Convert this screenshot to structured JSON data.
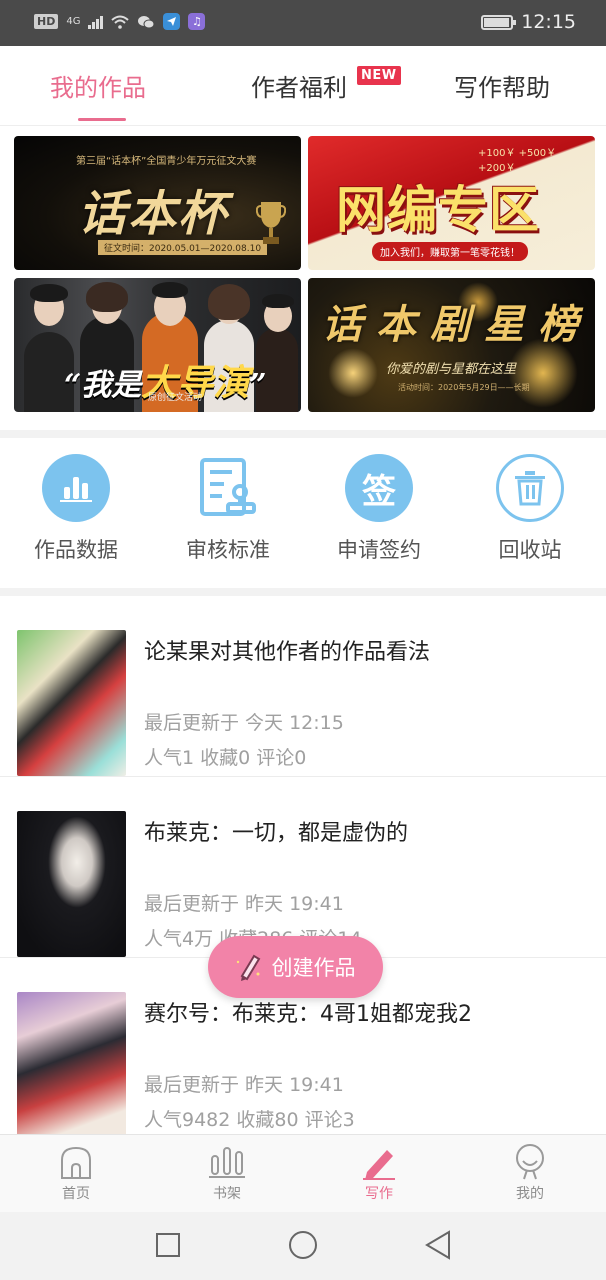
{
  "status_bar": {
    "hd_badge": "HD",
    "network": "4G",
    "time": "12:15",
    "battery_level": 0.9
  },
  "tabs": [
    {
      "label": "我的作品",
      "active": true
    },
    {
      "label": "作者福利",
      "badge": "NEW"
    },
    {
      "label": "写作帮助"
    }
  ],
  "banners": [
    {
      "title": "话本杯",
      "top_text": "第三届“话本杯”全国青少年万元征文大赛",
      "bottom_text": "征文时间：2020.05.01—2020.08.10"
    },
    {
      "title": "网编专区",
      "top_text": "+100￥  +500￥  +200￥",
      "bottom_text": "加入我们，赚取第一笔零花钱！"
    },
    {
      "title_prefix": "“我是",
      "title_main": "大导演",
      "title_suffix": "”",
      "bottom_text": "原创征文活动"
    },
    {
      "title": "话本剧星榜",
      "subtitle": "你爱的剧与星都在这里",
      "bottom_text": "活动时间：2020年5月29日——长期"
    }
  ],
  "actions": [
    {
      "label": "作品数据",
      "icon": "bar-chart-icon",
      "color": "#7cc3ee"
    },
    {
      "label": "审核标准",
      "icon": "review-document-icon",
      "color": "#7cc3ee"
    },
    {
      "label": "申请签约",
      "icon": "sign-icon",
      "icon_text": "签",
      "color": "#7cc3ee"
    },
    {
      "label": "回收站",
      "icon": "trash-icon",
      "color": "#7cc3ee"
    }
  ],
  "works": [
    {
      "title": "论某果对其他作者的作品看法",
      "updated": "最后更新于 今天 12:15",
      "stats": "人气1 收藏0 评论0"
    },
    {
      "title": "布莱克：一切，都是虚伪的",
      "updated": "最后更新于 昨天 19:41",
      "stats": "人气4万 收藏286 评论14"
    },
    {
      "title": "赛尔号：布莱克：4哥1姐都宠我2",
      "updated": "最后更新于 昨天 19:41",
      "stats": "人气9482 收藏80 评论3"
    }
  ],
  "fab": {
    "label": "创建作品"
  },
  "bottom_nav": [
    {
      "label": "首页",
      "icon": "home-icon"
    },
    {
      "label": "书架",
      "icon": "bookshelf-icon"
    },
    {
      "label": "写作",
      "icon": "pen-icon",
      "active": true
    },
    {
      "label": "我的",
      "icon": "profile-icon"
    }
  ],
  "colors": {
    "accent": "#e96c8e",
    "action_icon": "#7cc3ee",
    "fab": "#f283a8",
    "new_badge": "#e8344d"
  }
}
